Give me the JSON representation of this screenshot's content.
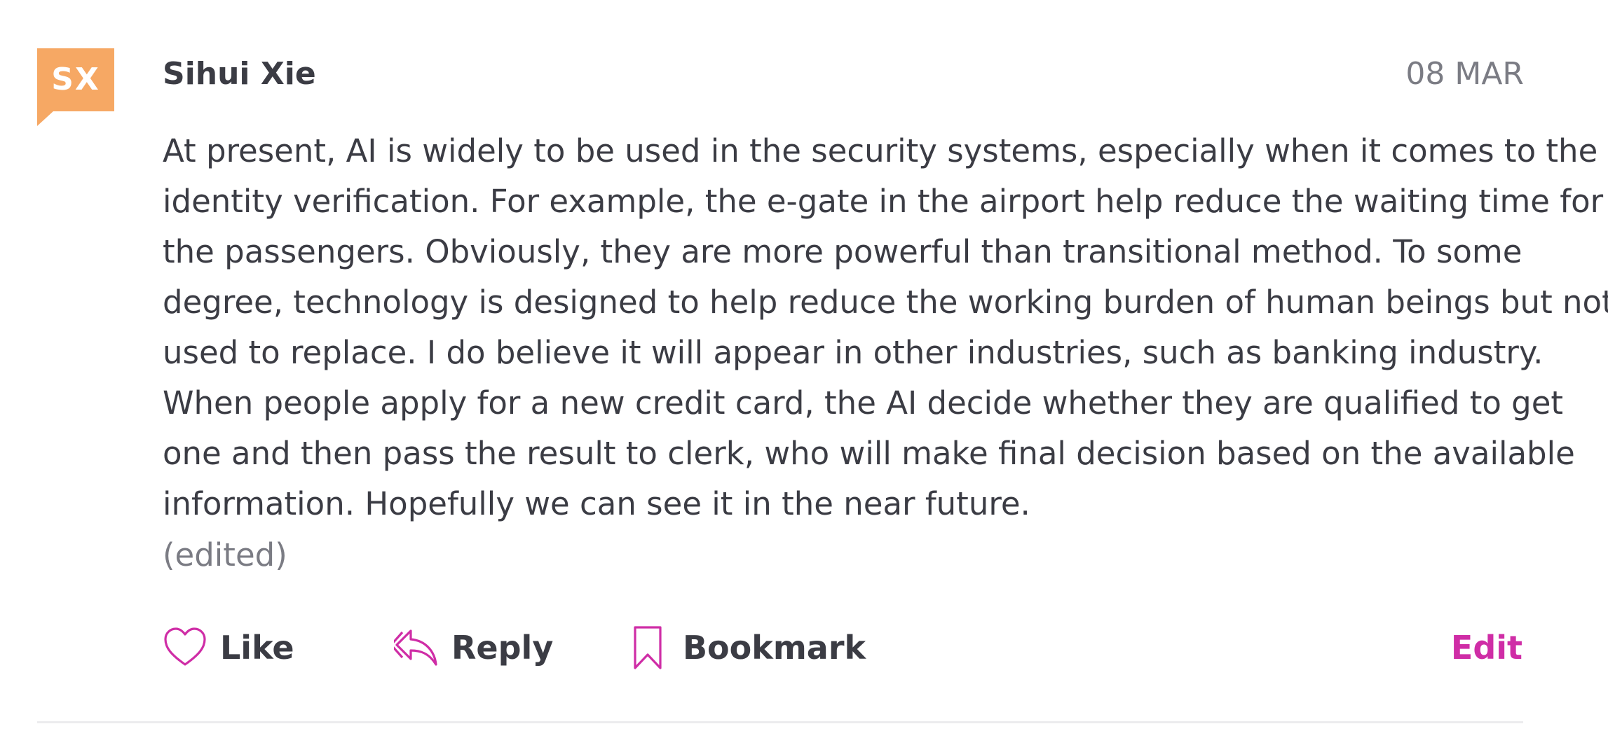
{
  "comment": {
    "avatar_initials": "SX",
    "avatar_color": "#f6a864",
    "author": "Sihui Xie",
    "date": "08 MAR",
    "body_lines": [
      "At present, AI is widely to be used in the security systems, especially when it comes to the",
      "identity verification. For example, the e-gate in the airport help reduce the waiting time for",
      "the passengers. Obviously, they are more powerful than transitional method. To some",
      "degree, technology is designed to help reduce the working burden of human beings but not",
      "used to replace. I do believe it will appear in other industries, such as banking industry.",
      "When people apply for a new credit card, the AI decide whether they are qualified to get",
      "one and then pass the result to clerk, who will make final decision based on the available",
      "information. Hopefully we can see it in the near future."
    ],
    "edited_label": "(edited)"
  },
  "actions": {
    "like_label": "Like",
    "reply_label": "Reply",
    "bookmark_label": "Bookmark",
    "edit_label": "Edit",
    "accent_color": "#cf2da6"
  },
  "icons": {
    "like": "heart-icon",
    "reply": "reply-arrow-icon",
    "bookmark": "bookmark-icon"
  }
}
